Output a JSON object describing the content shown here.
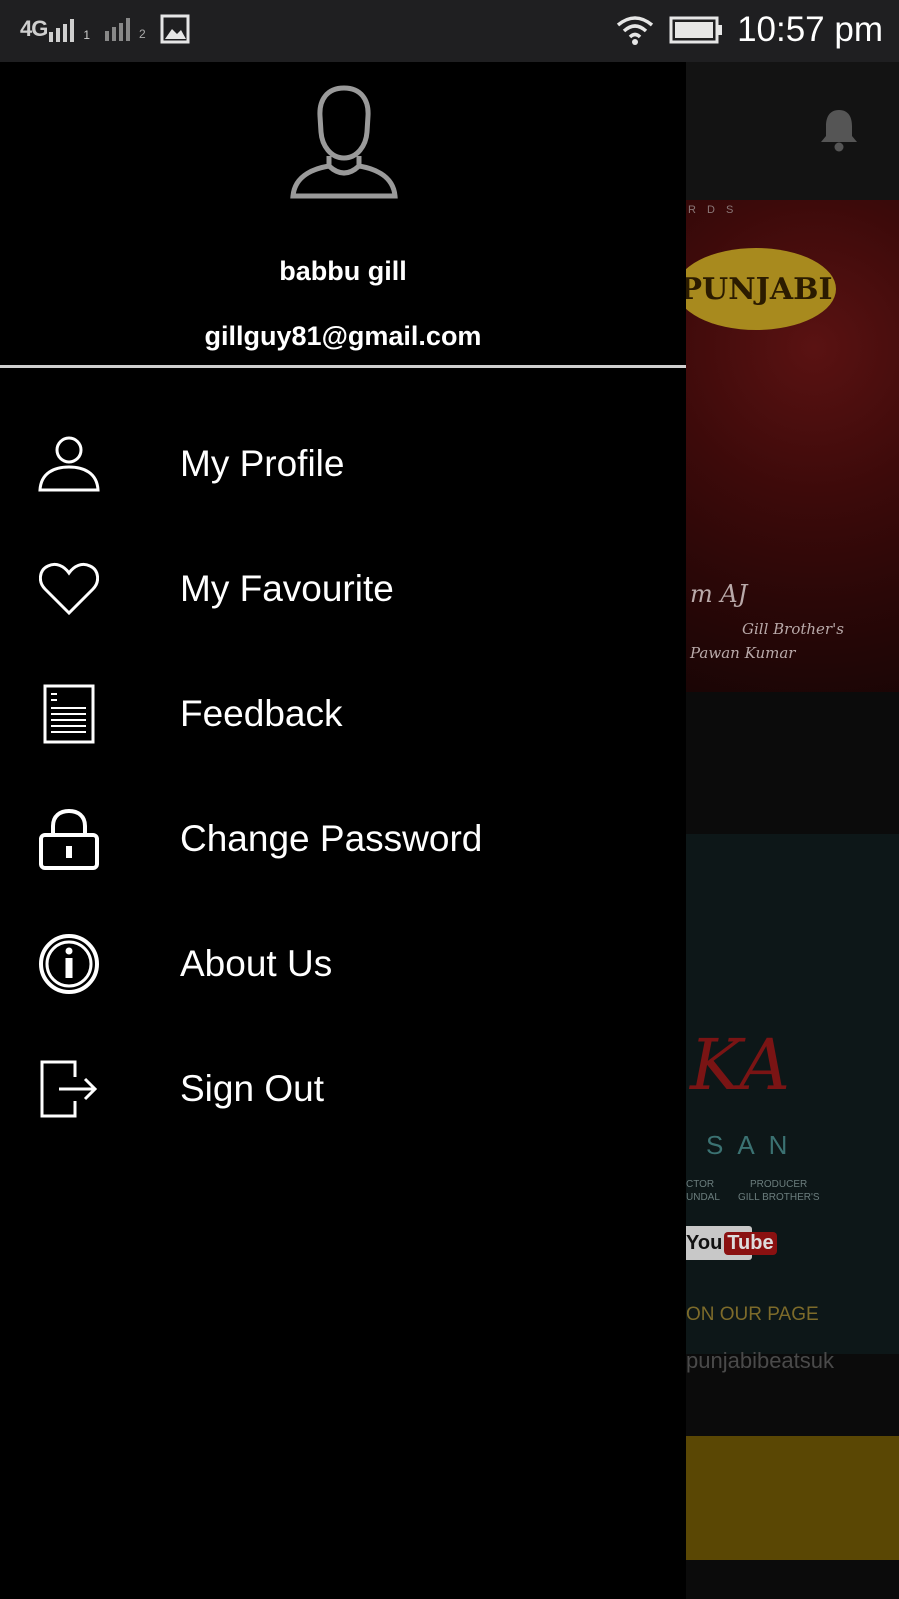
{
  "status_bar": {
    "network_label": "4G",
    "sim1": "1",
    "sim2": "2",
    "time": "10:57 pm",
    "icons": [
      "signal-icon",
      "gallery-icon",
      "wifi-icon",
      "battery-icon"
    ]
  },
  "drawer": {
    "user_name": "babbu gill",
    "user_email": "gillguy81@gmail.com",
    "menu_items": [
      {
        "label": "My Profile",
        "icon": "person-icon"
      },
      {
        "label": "My Favourite",
        "icon": "heart-icon"
      },
      {
        "label": "Feedback",
        "icon": "document-icon"
      },
      {
        "label": "Change Password",
        "icon": "lock-icon"
      },
      {
        "label": "About Us",
        "icon": "info-icon"
      },
      {
        "label": "Sign Out",
        "icon": "sign-out-icon"
      }
    ]
  },
  "background": {
    "poster1_top": "R D S",
    "poster1_logo": "PUNJABI",
    "poster1_line1": "m AJ",
    "poster1_line2": "Gill Brother's",
    "poster1_line3": "Pawan Kumar",
    "poster2_script": "KA",
    "poster2_san": "SAN",
    "poster2_credits_a": "CTOR",
    "poster2_credits_b": "PRODUCER",
    "poster2_credits_c": "UNDAL",
    "poster2_credits_d": "GILL BROTHER'S",
    "poster2_yt_a": "You",
    "poster2_yt_b": "Tube",
    "poster2_ourpage": "ON OUR PAGE",
    "handle": "punjabibeatsuk"
  },
  "colors": {
    "drawer_bg": "#000000",
    "status_bar_bg": "#1f1f21",
    "divider": "#cfcfcf",
    "text": "#ffffff"
  }
}
